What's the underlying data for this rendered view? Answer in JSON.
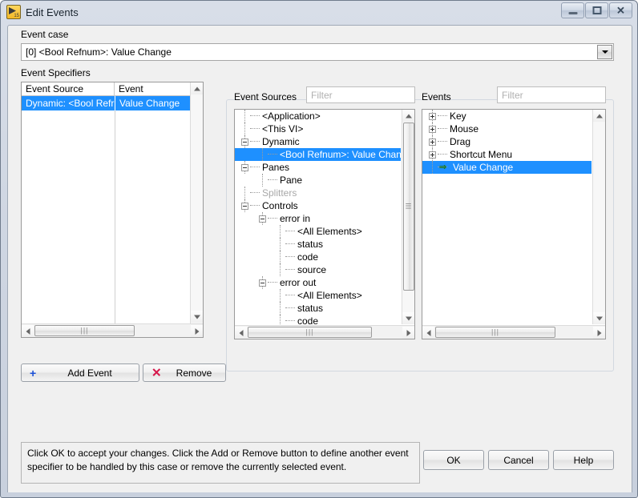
{
  "window": {
    "title": "Edit Events",
    "icon": "labview-event-icon",
    "controls": {
      "minimize": "Minimize",
      "maximize": "Maximize",
      "close": "Close"
    }
  },
  "event_case": {
    "label": "Event case",
    "value": "[0] <Bool Refnum>: Value Change",
    "dropdown_icon": "chevron-down-icon"
  },
  "event_specifiers": {
    "label": "Event Specifiers",
    "columns": [
      "Event Source",
      "Event"
    ],
    "rows": [
      {
        "source": "Dynamic: <Bool Refr",
        "event": "Value Change",
        "selected": true
      }
    ]
  },
  "event_sources": {
    "label": "Event Sources",
    "filter_placeholder": "Filter",
    "filter_value": "",
    "nodes": [
      {
        "label": "<Application>",
        "depth": 1,
        "expander": "none",
        "selected": false,
        "dim": false
      },
      {
        "label": "<This VI>",
        "depth": 1,
        "expander": "none",
        "selected": false,
        "dim": false
      },
      {
        "label": "Dynamic",
        "depth": 1,
        "expander": "minus",
        "selected": false,
        "dim": false
      },
      {
        "label": "<Bool Refnum>: Value Chang",
        "depth": 2,
        "expander": "none",
        "selected": true,
        "dim": false
      },
      {
        "label": "Panes",
        "depth": 1,
        "expander": "minus",
        "selected": false,
        "dim": false
      },
      {
        "label": "Pane",
        "depth": 2,
        "expander": "none",
        "selected": false,
        "dim": false
      },
      {
        "label": "Splitters",
        "depth": 1,
        "expander": "none",
        "selected": false,
        "dim": true
      },
      {
        "label": "Controls",
        "depth": 1,
        "expander": "minus",
        "selected": false,
        "dim": false
      },
      {
        "label": "error in",
        "depth": 2,
        "expander": "minus",
        "selected": false,
        "dim": false
      },
      {
        "label": "<All Elements>",
        "depth": 3,
        "expander": "none",
        "selected": false,
        "dim": false
      },
      {
        "label": "status",
        "depth": 3,
        "expander": "none",
        "selected": false,
        "dim": false
      },
      {
        "label": "code",
        "depth": 3,
        "expander": "none",
        "selected": false,
        "dim": false
      },
      {
        "label": "source",
        "depth": 3,
        "expander": "none",
        "selected": false,
        "dim": false
      },
      {
        "label": "error out",
        "depth": 2,
        "expander": "minus",
        "selected": false,
        "dim": false
      },
      {
        "label": "<All Elements>",
        "depth": 3,
        "expander": "none",
        "selected": false,
        "dim": false
      },
      {
        "label": "status",
        "depth": 3,
        "expander": "none",
        "selected": false,
        "dim": false
      },
      {
        "label": "code",
        "depth": 3,
        "expander": "none",
        "selected": false,
        "dim": false
      }
    ]
  },
  "events": {
    "label": "Events",
    "filter_placeholder": "Filter",
    "filter_value": "",
    "nodes": [
      {
        "label": "Key",
        "depth": 1,
        "expander": "plus",
        "selected": false,
        "arrow": false
      },
      {
        "label": "Mouse",
        "depth": 1,
        "expander": "plus",
        "selected": false,
        "arrow": false
      },
      {
        "label": "Drag",
        "depth": 1,
        "expander": "plus",
        "selected": false,
        "arrow": false
      },
      {
        "label": "Shortcut Menu",
        "depth": 1,
        "expander": "plus",
        "selected": false,
        "arrow": false
      },
      {
        "label": "Value Change",
        "depth": 1,
        "expander": "none",
        "selected": true,
        "arrow": true
      }
    ]
  },
  "actions": {
    "add_event": {
      "label": "Add Event",
      "icon": "plus-icon",
      "icon_color": "#1a4fd6"
    },
    "remove": {
      "label": "Remove",
      "icon": "x-icon",
      "icon_color": "#d6174a"
    }
  },
  "help_text": "Click OK to accept your changes.  Click the Add or Remove button to define another event specifier to be handled by this case or remove the currently selected event.",
  "dialog_buttons": {
    "ok": "OK",
    "cancel": "Cancel",
    "help": "Help"
  },
  "colors": {
    "selection_blue": "#1e90ff",
    "window_chrome": "#d8dee8",
    "dialog_background": "#f0f0f0",
    "arrow_green": "#1a7a2a"
  },
  "scrollbars": {
    "grip": "|||"
  }
}
